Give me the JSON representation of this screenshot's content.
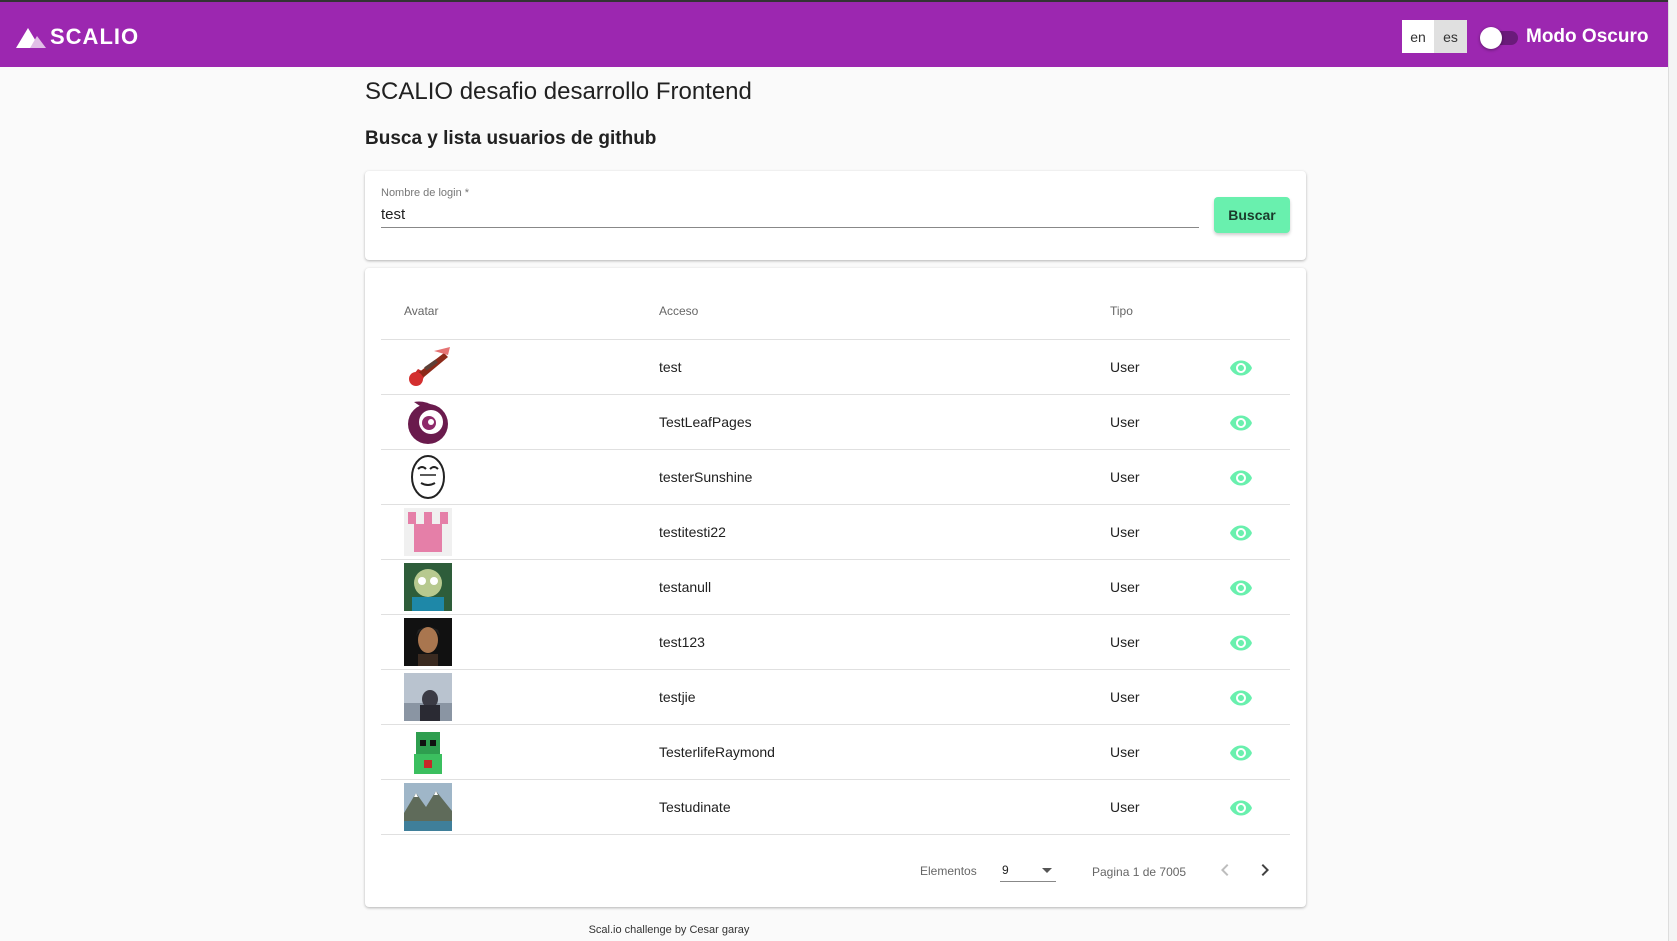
{
  "header": {
    "brand": "SCALIO",
    "languages": [
      "en",
      "es"
    ],
    "dark_mode_label": "Modo Oscuro",
    "colors": {
      "primary": "#9c27b0",
      "accent": "#69f0ae"
    }
  },
  "page": {
    "title": "SCALIO desafio desarrollo Frontend",
    "subtitle": "Busca y lista usuarios de github"
  },
  "search": {
    "label": "Nombre de login *",
    "value": "test",
    "button_label": "Buscar"
  },
  "table": {
    "columns": {
      "avatar": "Avatar",
      "login": "Acceso",
      "type": "Tipo"
    },
    "rows": [
      {
        "login": "test",
        "type": "User",
        "avatar": "guitar-avatar"
      },
      {
        "login": "TestLeafPages",
        "type": "User",
        "avatar": "swirl-logo-avatar"
      },
      {
        "login": "testerSunshine",
        "type": "User",
        "avatar": "meme-face-avatar"
      },
      {
        "login": "testitesti22",
        "type": "User",
        "avatar": "identicon-avatar"
      },
      {
        "login": "testanull",
        "type": "User",
        "avatar": "cartoon-avatar"
      },
      {
        "login": "test123",
        "type": "User",
        "avatar": "portrait-avatar"
      },
      {
        "login": "testjie",
        "type": "User",
        "avatar": "photo-avatar"
      },
      {
        "login": "TesterlifeRaymond",
        "type": "User",
        "avatar": "green-character-avatar"
      },
      {
        "login": "Testudinate",
        "type": "User",
        "avatar": "landscape-avatar"
      }
    ]
  },
  "pagination": {
    "items_label": "Elementos",
    "items_per_page": "9",
    "page_info": "Pagina 1 de 7005"
  },
  "footer": {
    "text": "Scal.io challenge by Cesar garay"
  }
}
